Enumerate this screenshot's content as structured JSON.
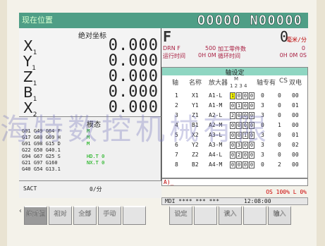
{
  "header": {
    "title": "现在位置",
    "program": "O0000 N00000"
  },
  "absolute": {
    "title": "绝对坐标",
    "axes": [
      {
        "name": "X",
        "sub": "1",
        "value": "0.000"
      },
      {
        "name": "Y",
        "sub": "1",
        "value": "0.000"
      },
      {
        "name": "Z",
        "sub": "1",
        "value": "0.000"
      },
      {
        "name": "B",
        "sub": "1",
        "value": "0.000"
      },
      {
        "name": "X",
        "sub": "2",
        "value": "0.000"
      }
    ]
  },
  "feed": {
    "label": "F",
    "value": "0",
    "unit": "毫米/分"
  },
  "info": {
    "drn_label": "DRN F",
    "drn_value": "500",
    "parts_label": "加工零件数",
    "parts_value": "0",
    "run_label": "运行时间",
    "run_value": "0H 0M",
    "cycle_label": "循环时间",
    "cycle_value": "0H 0M 0S"
  },
  "axis_settings": {
    "title": "轴设定",
    "headers": [
      "轴",
      "名称",
      "放大器",
      "M\n1234",
      "轴专有",
      "CS",
      "双电"
    ],
    "bit_header": "1 2 3 4",
    "rows": [
      {
        "no": "1",
        "name": "X1",
        "amp": "A1-L",
        "bits": [
          "1",
          "0",
          "0",
          "0"
        ],
        "own": "0",
        "cs": "0",
        "dual": "00"
      },
      {
        "no": "2",
        "name": "Y1",
        "amp": "A1-M",
        "bits": [
          "0",
          "1",
          "0",
          "0"
        ],
        "own": "3",
        "cs": "0",
        "dual": "01"
      },
      {
        "no": "3",
        "name": "Z1",
        "amp": "A2-L",
        "bits": [
          "2",
          "0",
          "0",
          "0"
        ],
        "own": "3",
        "cs": "0",
        "dual": "00"
      },
      {
        "no": "4",
        "name": "B1",
        "amp": "A2-M",
        "bits": [
          "0",
          "0",
          "0",
          "0"
        ],
        "own": "0",
        "cs": "1",
        "dual": "00"
      },
      {
        "no": "5",
        "name": "X2",
        "amp": "A3-L",
        "bits": [
          "0",
          "0",
          "1",
          "0"
        ],
        "own": "3",
        "cs": "0",
        "dual": "01"
      },
      {
        "no": "6",
        "name": "Y2",
        "amp": "A3-M",
        "bits": [
          "0",
          "3",
          "0",
          "0"
        ],
        "own": "3",
        "cs": "0",
        "dual": "02"
      },
      {
        "no": "7",
        "name": "Z2",
        "amp": "A4-L",
        "bits": [
          "0",
          "2",
          "0",
          "0"
        ],
        "own": "3",
        "cs": "0",
        "dual": "00"
      },
      {
        "no": "8",
        "name": "B2",
        "amp": "A4-M",
        "bits": [
          "0",
          "0",
          "0",
          "0"
        ],
        "own": "0",
        "cs": "2",
        "dual": "00"
      }
    ]
  },
  "modal": {
    "title": "模态",
    "lines": [
      "G01  G49  G64  F",
      "G17  G80  G69  H",
      "G91  G98  G15  D",
      "G22  G50  G40.1",
      "G94  G67  G25  S",
      "G21  G97  G160",
      "G40  G54  G13.1"
    ],
    "right": [
      "M",
      "M",
      "M",
      "",
      "HD.T      0",
      "NX.T      0",
      ""
    ]
  },
  "sact": {
    "label": "SACT",
    "value": "0/分"
  },
  "command": {
    "prompt": "A)_"
  },
  "status": {
    "os": "OS 100% L  0%",
    "mode": "MDI  **** *** ***",
    "time": "12:08:00"
  },
  "softkeys_left": [
    "绝对值",
    "相对",
    "全部",
    "手动",
    ""
  ],
  "softkeys_right": [
    "设定",
    "",
    "读入",
    "",
    "输入",
    ""
  ],
  "watermark": "海特数控机械有限"
}
